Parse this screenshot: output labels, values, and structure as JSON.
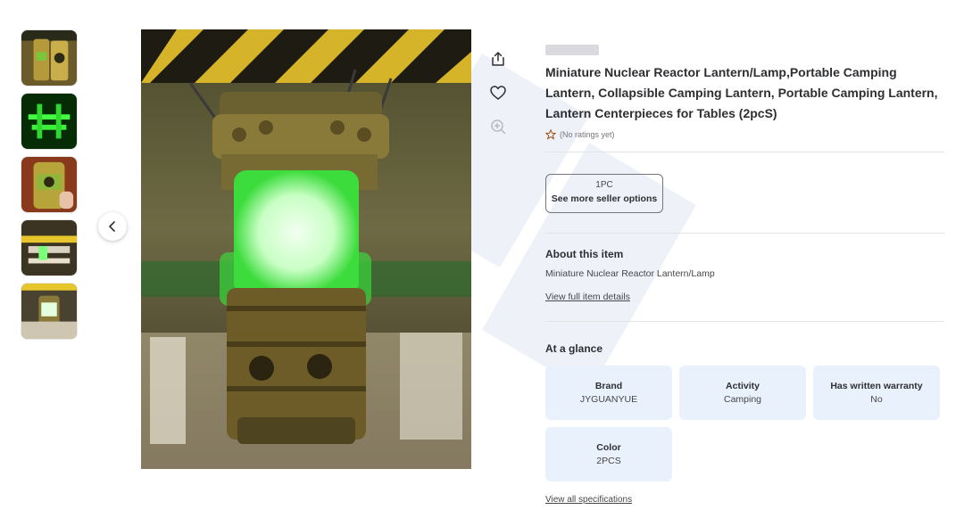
{
  "product": {
    "title": "Miniature Nuclear Reactor Lantern/Lamp,Portable Camping Lantern, Collapsible Camping Lantern, Portable Camping Lantern, Lantern Centerpieces for Tables (2pcS)",
    "rating_text": "(No ratings yet)"
  },
  "seller_option": {
    "quantity": "1PC",
    "label": "See more seller options"
  },
  "about": {
    "heading": "About this item",
    "description": "Miniature Nuclear Reactor Lantern/Lamp",
    "link": "View full item details"
  },
  "glance": {
    "heading": "At a glance",
    "items": [
      {
        "key": "Brand",
        "value": "JYGUANYUE"
      },
      {
        "key": "Activity",
        "value": "Camping"
      },
      {
        "key": "Has written warranty",
        "value": "No"
      },
      {
        "key": "Color",
        "value": "2PCS"
      }
    ],
    "link": "View all specifications"
  },
  "icons": {
    "share": "share-icon",
    "favorite": "heart-icon",
    "zoom": "zoom-in-icon",
    "prev": "chevron-left-icon",
    "rating": "star-outline-icon"
  },
  "colors": {
    "accent_star": "#995213",
    "glance_bg": "#e9f1fc",
    "lantern_glow": "#7dff7a"
  }
}
